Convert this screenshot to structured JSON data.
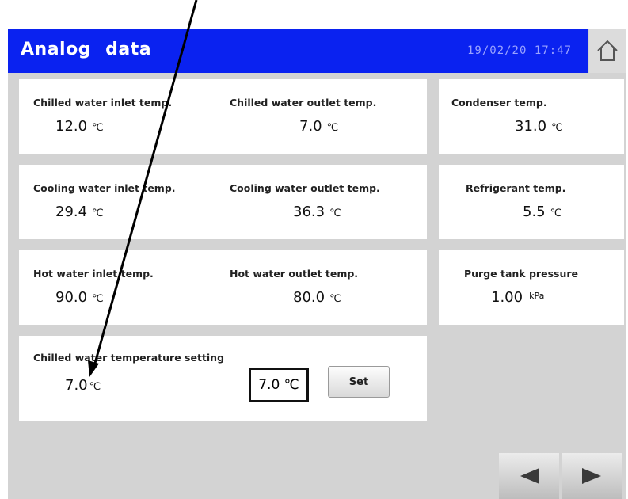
{
  "header": {
    "title": "Analog data",
    "datetime": "19/02/20 17:47",
    "home_icon": "home-icon"
  },
  "readings": {
    "chilled_inlet": {
      "label": "Chilled water inlet temp.",
      "value": "12.0",
      "unit": "℃"
    },
    "chilled_outlet": {
      "label": "Chilled water outlet temp.",
      "value": "7.0",
      "unit": "℃"
    },
    "condenser": {
      "label": "Condenser temp.",
      "value": "31.0",
      "unit": "℃"
    },
    "cooling_inlet": {
      "label": "Cooling water inlet temp.",
      "value": "29.4",
      "unit": "℃"
    },
    "cooling_outlet": {
      "label": "Cooling water outlet temp.",
      "value": "36.3",
      "unit": "℃"
    },
    "refrigerant": {
      "label": "Refrigerant temp.",
      "value": "5.5",
      "unit": "℃"
    },
    "hot_inlet": {
      "label": "Hot water inlet temp.",
      "value": "90.0",
      "unit": "℃"
    },
    "hot_outlet": {
      "label": "Hot water outlet temp.",
      "value": "80.0",
      "unit": "℃"
    },
    "purge_tank": {
      "label": "Purge tank pressure",
      "value": "1.00",
      "unit": "kPa"
    }
  },
  "setting": {
    "label": "Chilled water temperature setting",
    "current": "7.0",
    "current_unit": "℃",
    "input_value": "7.0 ℃",
    "set_label": "Set"
  },
  "nav": {
    "prev_icon": "triangle-left-icon",
    "next_icon": "triangle-right-icon"
  },
  "colors": {
    "header_bg": "#0a22f0",
    "screen_bg": "#d3d3d3",
    "panel_bg": "#ffffff"
  }
}
